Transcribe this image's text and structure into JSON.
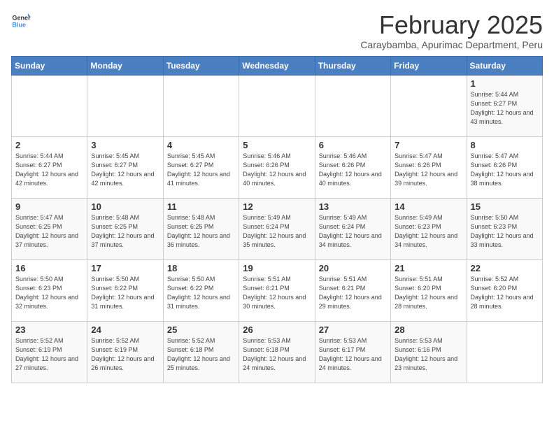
{
  "header": {
    "logo_general": "General",
    "logo_blue": "Blue",
    "title": "February 2025",
    "subtitle": "Caraybamba, Apurimac Department, Peru"
  },
  "weekdays": [
    "Sunday",
    "Monday",
    "Tuesday",
    "Wednesday",
    "Thursday",
    "Friday",
    "Saturday"
  ],
  "weeks": [
    [
      {
        "day": "",
        "info": ""
      },
      {
        "day": "",
        "info": ""
      },
      {
        "day": "",
        "info": ""
      },
      {
        "day": "",
        "info": ""
      },
      {
        "day": "",
        "info": ""
      },
      {
        "day": "",
        "info": ""
      },
      {
        "day": "1",
        "info": "Sunrise: 5:44 AM\nSunset: 6:27 PM\nDaylight: 12 hours and 43 minutes."
      }
    ],
    [
      {
        "day": "2",
        "info": "Sunrise: 5:44 AM\nSunset: 6:27 PM\nDaylight: 12 hours and 42 minutes."
      },
      {
        "day": "3",
        "info": "Sunrise: 5:45 AM\nSunset: 6:27 PM\nDaylight: 12 hours and 42 minutes."
      },
      {
        "day": "4",
        "info": "Sunrise: 5:45 AM\nSunset: 6:27 PM\nDaylight: 12 hours and 41 minutes."
      },
      {
        "day": "5",
        "info": "Sunrise: 5:46 AM\nSunset: 6:26 PM\nDaylight: 12 hours and 40 minutes."
      },
      {
        "day": "6",
        "info": "Sunrise: 5:46 AM\nSunset: 6:26 PM\nDaylight: 12 hours and 40 minutes."
      },
      {
        "day": "7",
        "info": "Sunrise: 5:47 AM\nSunset: 6:26 PM\nDaylight: 12 hours and 39 minutes."
      },
      {
        "day": "8",
        "info": "Sunrise: 5:47 AM\nSunset: 6:26 PM\nDaylight: 12 hours and 38 minutes."
      }
    ],
    [
      {
        "day": "9",
        "info": "Sunrise: 5:47 AM\nSunset: 6:25 PM\nDaylight: 12 hours and 37 minutes."
      },
      {
        "day": "10",
        "info": "Sunrise: 5:48 AM\nSunset: 6:25 PM\nDaylight: 12 hours and 37 minutes."
      },
      {
        "day": "11",
        "info": "Sunrise: 5:48 AM\nSunset: 6:25 PM\nDaylight: 12 hours and 36 minutes."
      },
      {
        "day": "12",
        "info": "Sunrise: 5:49 AM\nSunset: 6:24 PM\nDaylight: 12 hours and 35 minutes."
      },
      {
        "day": "13",
        "info": "Sunrise: 5:49 AM\nSunset: 6:24 PM\nDaylight: 12 hours and 34 minutes."
      },
      {
        "day": "14",
        "info": "Sunrise: 5:49 AM\nSunset: 6:23 PM\nDaylight: 12 hours and 34 minutes."
      },
      {
        "day": "15",
        "info": "Sunrise: 5:50 AM\nSunset: 6:23 PM\nDaylight: 12 hours and 33 minutes."
      }
    ],
    [
      {
        "day": "16",
        "info": "Sunrise: 5:50 AM\nSunset: 6:23 PM\nDaylight: 12 hours and 32 minutes."
      },
      {
        "day": "17",
        "info": "Sunrise: 5:50 AM\nSunset: 6:22 PM\nDaylight: 12 hours and 31 minutes."
      },
      {
        "day": "18",
        "info": "Sunrise: 5:50 AM\nSunset: 6:22 PM\nDaylight: 12 hours and 31 minutes."
      },
      {
        "day": "19",
        "info": "Sunrise: 5:51 AM\nSunset: 6:21 PM\nDaylight: 12 hours and 30 minutes."
      },
      {
        "day": "20",
        "info": "Sunrise: 5:51 AM\nSunset: 6:21 PM\nDaylight: 12 hours and 29 minutes."
      },
      {
        "day": "21",
        "info": "Sunrise: 5:51 AM\nSunset: 6:20 PM\nDaylight: 12 hours and 28 minutes."
      },
      {
        "day": "22",
        "info": "Sunrise: 5:52 AM\nSunset: 6:20 PM\nDaylight: 12 hours and 28 minutes."
      }
    ],
    [
      {
        "day": "23",
        "info": "Sunrise: 5:52 AM\nSunset: 6:19 PM\nDaylight: 12 hours and 27 minutes."
      },
      {
        "day": "24",
        "info": "Sunrise: 5:52 AM\nSunset: 6:19 PM\nDaylight: 12 hours and 26 minutes."
      },
      {
        "day": "25",
        "info": "Sunrise: 5:52 AM\nSunset: 6:18 PM\nDaylight: 12 hours and 25 minutes."
      },
      {
        "day": "26",
        "info": "Sunrise: 5:53 AM\nSunset: 6:18 PM\nDaylight: 12 hours and 24 minutes."
      },
      {
        "day": "27",
        "info": "Sunrise: 5:53 AM\nSunset: 6:17 PM\nDaylight: 12 hours and 24 minutes."
      },
      {
        "day": "28",
        "info": "Sunrise: 5:53 AM\nSunset: 6:16 PM\nDaylight: 12 hours and 23 minutes."
      },
      {
        "day": "",
        "info": ""
      }
    ]
  ]
}
